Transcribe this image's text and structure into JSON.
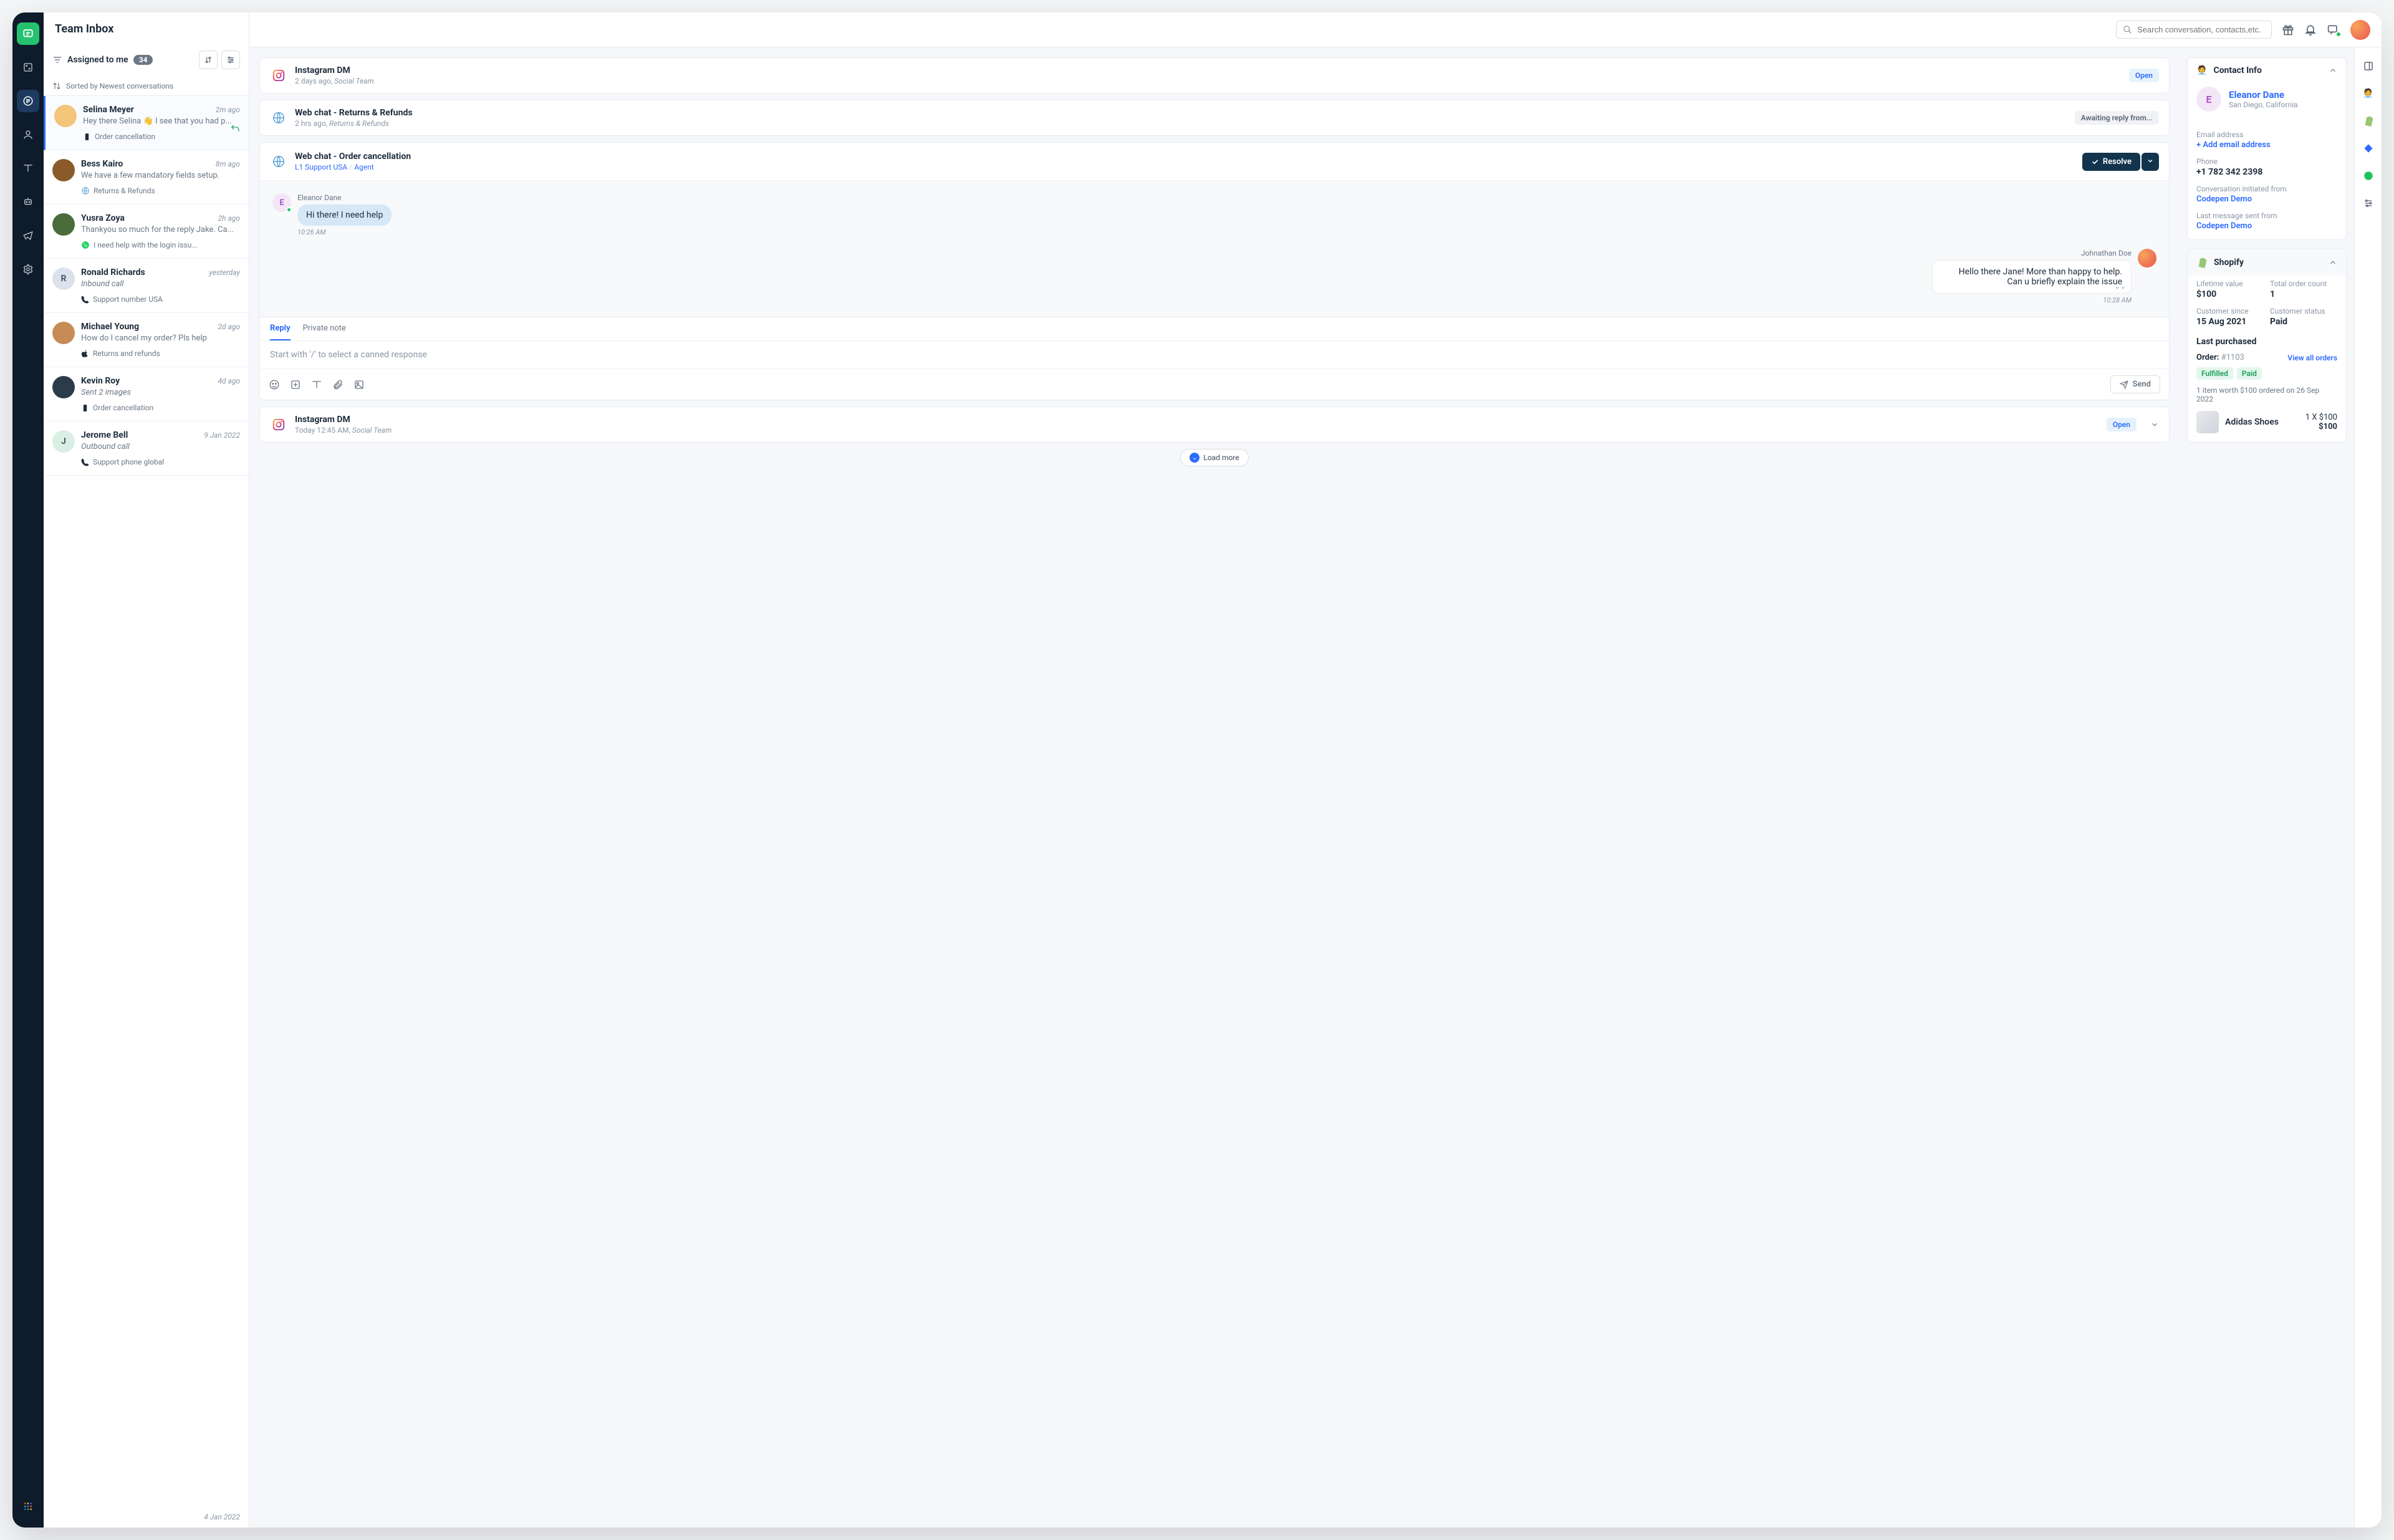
{
  "header": {
    "title": "Team Inbox",
    "search_placeholder": "Search conversation, contacts,etc."
  },
  "filter": {
    "label": "Assigned to me",
    "count": "34",
    "sort": "Sorted by Newest conversations"
  },
  "conversations": [
    {
      "name": "Selina Meyer",
      "time": "2m ago",
      "preview": "Hey there Selina 👋 I see that you had p...",
      "tag": "Order cancellation",
      "icon": "mobile",
      "showReply": true,
      "avatar": "img1"
    },
    {
      "name": "Bess Kairo",
      "time": "8m ago",
      "preview": "We have a few mandatory fields setup.",
      "tag": "Returns & Refunds",
      "icon": "globe",
      "avatar": "img2"
    },
    {
      "name": "Yusra Zoya",
      "time": "2h ago",
      "preview": "Thankyou so much for the reply Jake. Ca...",
      "tag": "I need help with the login issu...",
      "icon": "whatsapp",
      "avatar": "img3"
    },
    {
      "name": "Ronald Richards",
      "time": "yesterday",
      "preview": "Inbound call",
      "previewItalic": true,
      "tag": "Support number USA",
      "icon": "phone",
      "avatar": "letter-R"
    },
    {
      "name": "Michael Young",
      "time": "2d ago",
      "preview": "How do I cancel my order? Pls help",
      "tag": "Returns and refunds",
      "icon": "apple",
      "avatar": "img4"
    },
    {
      "name": "Kevin Roy",
      "time": "4d ago",
      "preview": "Sent 2 images",
      "previewItalic": true,
      "tag": "Order cancellation",
      "icon": "mobile",
      "avatar": "img5"
    },
    {
      "name": "Jerome Bell",
      "time": "9 Jan 2022",
      "preview": "Outbound call",
      "previewItalic": true,
      "tag": "Support phone global",
      "icon": "phone",
      "avatar": "letter-J"
    }
  ],
  "floatDate": "4 Jan 2022",
  "threads": {
    "prev1": {
      "title": "Instagram DM",
      "sub_time": "2 days ago,",
      "sub_team": "Social Team",
      "chip": "Open"
    },
    "prev2": {
      "title": "Web chat - Returns & Refunds",
      "sub_time": "2 hrs ago,",
      "sub_team": "Returns & Refunds",
      "chip": "Awaiting reply from..."
    },
    "active": {
      "title": "Web chat - Order cancellation",
      "group": "L1 Support USA",
      "assignee": "Agent",
      "resolve": "Resolve",
      "msg_in_sender": "Eleanor Dane",
      "msg_in_text": "Hi there! I need help",
      "msg_in_time": "10:26 AM",
      "msg_out_sender": "Johnathan Doe",
      "msg_out_text": "Hello there Jane! More than happy to help. Can u briefly explain the issue",
      "msg_out_time": "10:28 AM"
    },
    "next": {
      "title": "Instagram DM",
      "sub_time": "Today 12:45 AM,",
      "sub_team": "Social Team",
      "chip": "Open"
    }
  },
  "reply": {
    "tab_reply": "Reply",
    "tab_private": "Private note",
    "placeholder": "Start with '/' to select a canned response",
    "send": "Send"
  },
  "load_more": "Load more",
  "contact": {
    "panel_title": "Contact Info",
    "avatar_letter": "E",
    "name": "Eleanor Dane",
    "location": "San Diego, California",
    "email_label": "Email address",
    "email_action": "+ Add email address",
    "phone_label": "Phone",
    "phone": "+1 782 342 2398",
    "init_label": "Conversation initiated from",
    "init_value": "Codepen Demo",
    "last_label": "Last message sent from",
    "last_value": "Codepen Demo"
  },
  "shopify": {
    "title": "Shopify",
    "ltv_label": "Lifetime value",
    "ltv": "$100",
    "orders_label": "Total order count",
    "orders": "1",
    "since_label": "Customer since",
    "since": "15 Aug 2021",
    "status_label": "Customer status",
    "status": "Paid",
    "last_purchased": "Last purchased",
    "order_label": "Order:",
    "order_id": "#1103",
    "view_all": "View all orders",
    "chip_fulfilled": "Fulfilled",
    "chip_paid": "Paid",
    "summary": "1 item worth $100 ordered on 26 Sep 2022",
    "product": "Adidas Shoes",
    "qty_price": "1 X $100",
    "total": "$100"
  }
}
